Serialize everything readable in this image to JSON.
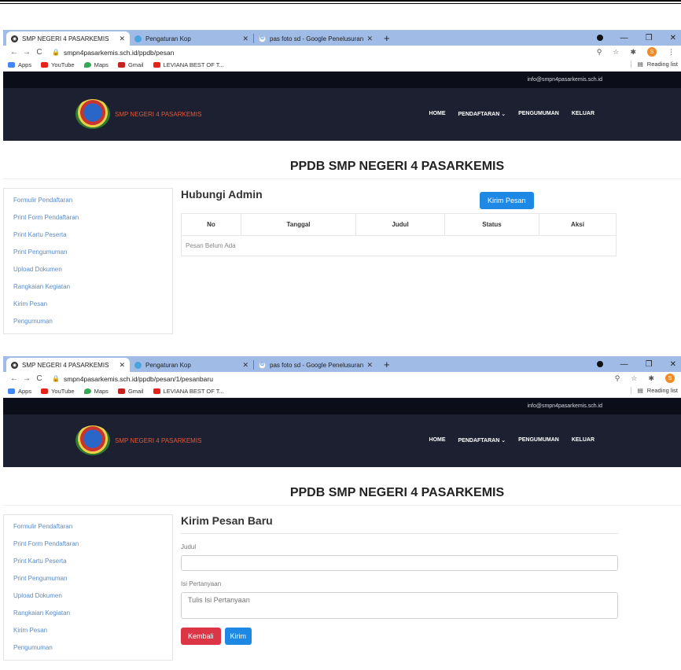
{
  "browser": {
    "tabs": [
      {
        "label": "SMP NEGERI 4 PASARKEMIS"
      },
      {
        "label": "Pengaturan Kop"
      },
      {
        "label": "pas foto sd - Google Penelusuran"
      }
    ],
    "new_tab": "+",
    "bookmarks": [
      {
        "label": "Apps",
        "color": "#4285f4"
      },
      {
        "label": "YouTube",
        "color": "#e62117"
      },
      {
        "label": "Maps",
        "color": "#34a853"
      },
      {
        "label": "Gmail",
        "color": "#c5221f"
      },
      {
        "label": "LEVIANA BEST OF T...",
        "color": "#e62117"
      }
    ],
    "reading_list": "Reading list",
    "profile_initial": "S"
  },
  "site": {
    "email": "info@smpn4pasarkemis.sch.id",
    "school_name": "SMP NEGERI 4 PASARKEMIS",
    "menu": [
      "HOME",
      "PENDAFTARAN ⌄",
      "PENGUMUMAN",
      "KELUAR"
    ],
    "page_title": "PPDB SMP NEGERI 4 PASARKEMIS",
    "sidebar": [
      "Formulir Pendaftaran",
      "Print Form Pendaftaran",
      "Print Kartu Peserta",
      "Print Pengumuman",
      "Upload Dokumen",
      "Rangkaian Kegiatan",
      "Kirim Pesan",
      "Pengumuman"
    ]
  },
  "shot1": {
    "url": "smpn4pasarkemis.sch.id/ppdb/pesan",
    "heading": "Hubungi Admin",
    "send_button": "Kirim Pesan",
    "columns": [
      "No",
      "Tanggal",
      "Judul",
      "Status",
      "Aksi"
    ],
    "empty_message": "Pesan Belum Ada"
  },
  "shot2": {
    "url": "smpn4pasarkemis.sch.id/ppdb/pesan/1/pesanbaru",
    "heading": "Kirim Pesan Baru",
    "title_label": "Judul",
    "title_value": "",
    "question_label": "Isi Pertanyaan",
    "question_placeholder": "Tulis Isi Pertanyaan",
    "back_button": "Kembali",
    "submit_button": "Kirim"
  }
}
